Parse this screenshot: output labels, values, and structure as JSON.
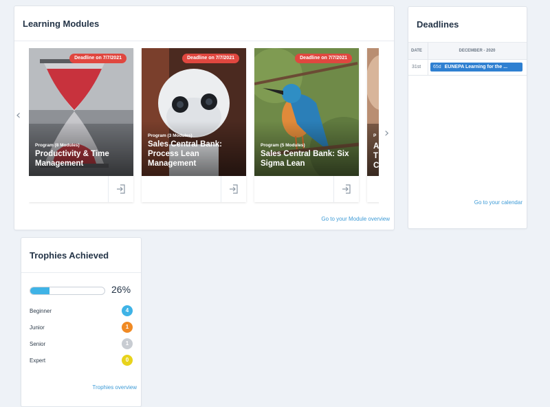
{
  "learning_modules": {
    "title": "Learning Modules",
    "overview_link": "Go to your Module overview",
    "prev_label": "‹",
    "next_label": "›",
    "cards": [
      {
        "deadline": "Deadline on 7/7/2021",
        "subtitle": "Program (8 Modules)",
        "title": "Productivity & Time Management",
        "image": "hourglass"
      },
      {
        "deadline": "Deadline on 7/7/2021",
        "subtitle": "Program (3 Modules)",
        "title": "Sales Central Bank: Process Lean Management",
        "image": "robot"
      },
      {
        "deadline": "Deadline on 7/7/2021",
        "subtitle": "Program (5 Modules)",
        "title": "Sales Central Bank: Six Sigma Lean",
        "image": "kingfisher"
      },
      {
        "deadline": "",
        "subtitle": "P",
        "title": "A T C",
        "image": "hand"
      }
    ]
  },
  "deadlines": {
    "title": "Deadlines",
    "col_date": "DATE",
    "col_month": "DECEMBER - 2020",
    "rows": [
      {
        "date": "31st",
        "days": "65d",
        "event": "EUNEPA Learning for the ..."
      }
    ],
    "calendar_link": "Go to your calendar",
    "event_color": "#2f80d1"
  },
  "trophies": {
    "title": "Trophies Achieved",
    "progress": 0.26,
    "progress_label": "26%",
    "overview_link": "Trophies overview",
    "levels": [
      {
        "label": "Beginner",
        "count": "4",
        "color": "#3fb3e6"
      },
      {
        "label": "Junior",
        "count": "1",
        "color": "#f08a24"
      },
      {
        "label": "Senior",
        "count": "1",
        "color": "#c8ccd2"
      },
      {
        "label": "Expert",
        "count": "0",
        "color": "#e8d31c"
      }
    ]
  },
  "colors": {
    "accent": "#3c9ad6",
    "deadline_badge": "#e0473f"
  },
  "icons": {
    "enter": "sign-in-icon",
    "prev": "chevron-left-icon",
    "next": "chevron-right-icon"
  }
}
